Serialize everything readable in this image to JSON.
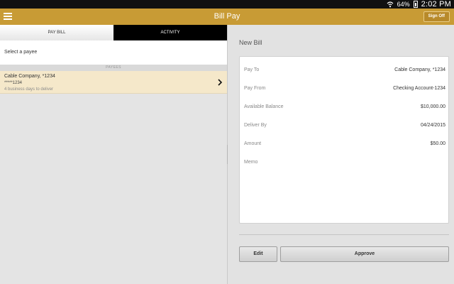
{
  "status_bar": {
    "battery": "64%",
    "time": "2:02 PM"
  },
  "header": {
    "title": "Bill Pay",
    "sign_off": "Sign Off"
  },
  "tabs": [
    {
      "label": "PAY BILL",
      "active": true
    },
    {
      "label": "ACTIVITY",
      "active": false
    }
  ],
  "payee_prompt": "Select a payee",
  "payees_header": "PAYEES",
  "payees": [
    {
      "name": "Cable Company, *1234",
      "account": "*****1234",
      "delivery": "4 business days to deliver"
    }
  ],
  "bill": {
    "title": "New Bill",
    "fields": [
      {
        "label": "Pay To",
        "value": "Cable Company, *1234"
      },
      {
        "label": "Pay From",
        "value": "Checking Account-1234"
      },
      {
        "label": "Available Balance",
        "value": "$10,000.00"
      },
      {
        "label": "Deliver By",
        "value": "04/24/2015"
      },
      {
        "label": "Amount",
        "value": "$50.00"
      },
      {
        "label": "Memo",
        "value": ""
      }
    ]
  },
  "actions": {
    "edit": "Edit",
    "approve": "Approve"
  },
  "colors": {
    "header_bg": "#c89b35",
    "selected_row_bg": "#f5e8ca",
    "active_tab_dark": "#000000"
  },
  "icons": {
    "menu": "hamburger-icon",
    "chevron": "chevron-right-icon",
    "wifi": "wifi-icon",
    "battery": "battery-icon"
  }
}
